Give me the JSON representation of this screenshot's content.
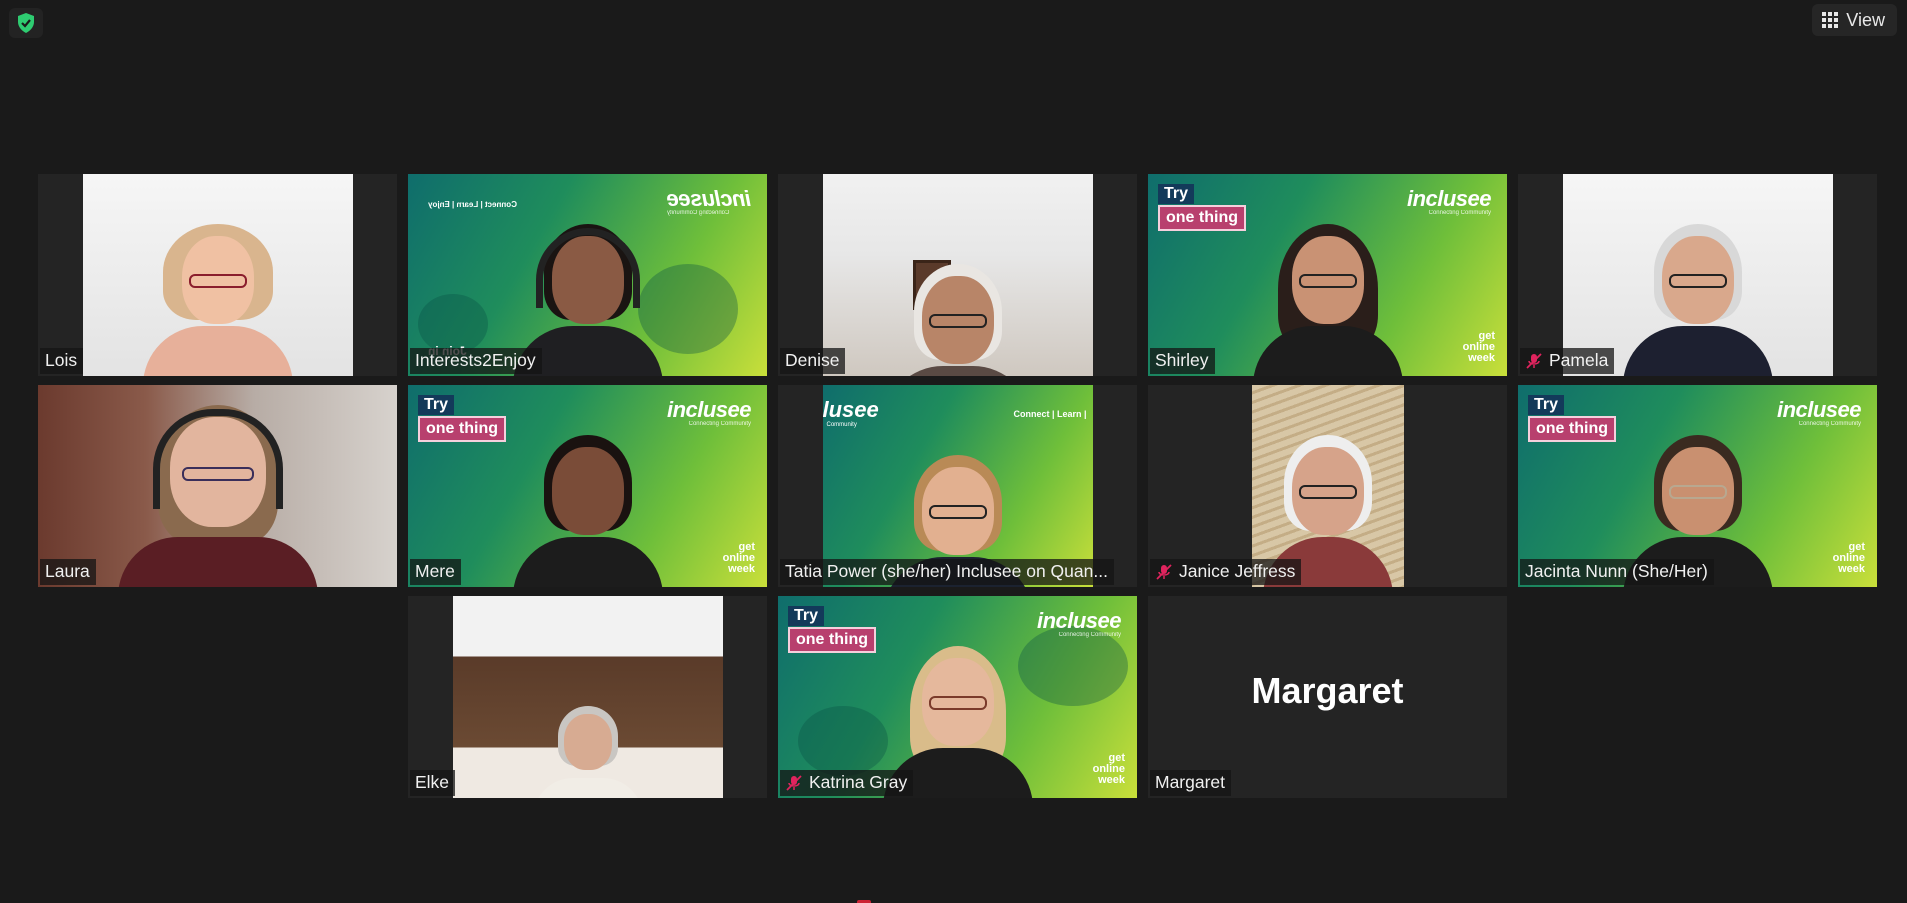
{
  "topbar": {
    "view_label": "View",
    "view_icon": "grid-icon",
    "security_icon": "shield-check-icon",
    "security_color": "#2ecc71"
  },
  "participants": [
    {
      "name": "Lois",
      "muted": false,
      "active": false,
      "kind": "webcam-white"
    },
    {
      "name": "Interests2Enjoy",
      "muted": false,
      "active": true,
      "kind": "branded-green"
    },
    {
      "name": "Denise",
      "muted": false,
      "active": false,
      "kind": "webcam-room"
    },
    {
      "name": "Shirley",
      "muted": false,
      "active": false,
      "kind": "branded-try"
    },
    {
      "name": "Pamela",
      "muted": true,
      "active": false,
      "kind": "webcam-white"
    },
    {
      "name": "Laura",
      "muted": false,
      "active": false,
      "kind": "webcam-laura"
    },
    {
      "name": "Mere",
      "muted": false,
      "active": false,
      "kind": "branded-try"
    },
    {
      "name": "Tatia Power (she/her) Inclusee on Quan...",
      "muted": false,
      "active": false,
      "kind": "branded-green"
    },
    {
      "name": "Janice Jeffress",
      "muted": true,
      "active": false,
      "kind": "webcam-wood"
    },
    {
      "name": "Jacinta Nunn (She/Her)",
      "muted": false,
      "active": false,
      "kind": "branded-try"
    },
    {
      "name": "Elke",
      "muted": false,
      "active": false,
      "kind": "webcam-shelf"
    },
    {
      "name": "Katrina Gray",
      "muted": true,
      "active": false,
      "kind": "branded-try"
    },
    {
      "name": "Margaret",
      "muted": false,
      "active": false,
      "kind": "no-video"
    }
  ],
  "branding": {
    "try_line1": "Try",
    "try_line2": "one thing",
    "brand_name": "inclusee",
    "brand_tagline": "Connecting Community",
    "brand_name_mirrored": "inclusee",
    "connect_line": "Connect | Learn | Enjoy",
    "connect_line_partial": "Connect | Learn |",
    "join_text": "Join in",
    "gow_line1": "get",
    "gow_line2": "online",
    "gow_line3": "week",
    "partial_brand": "lusee",
    "partial_tagline": "Community",
    "green": "#1f8d5c",
    "lime": "#c9df3a",
    "pink": "#b8406e",
    "navy": "#133a5a"
  },
  "margaret_placeholder": "Margaret"
}
